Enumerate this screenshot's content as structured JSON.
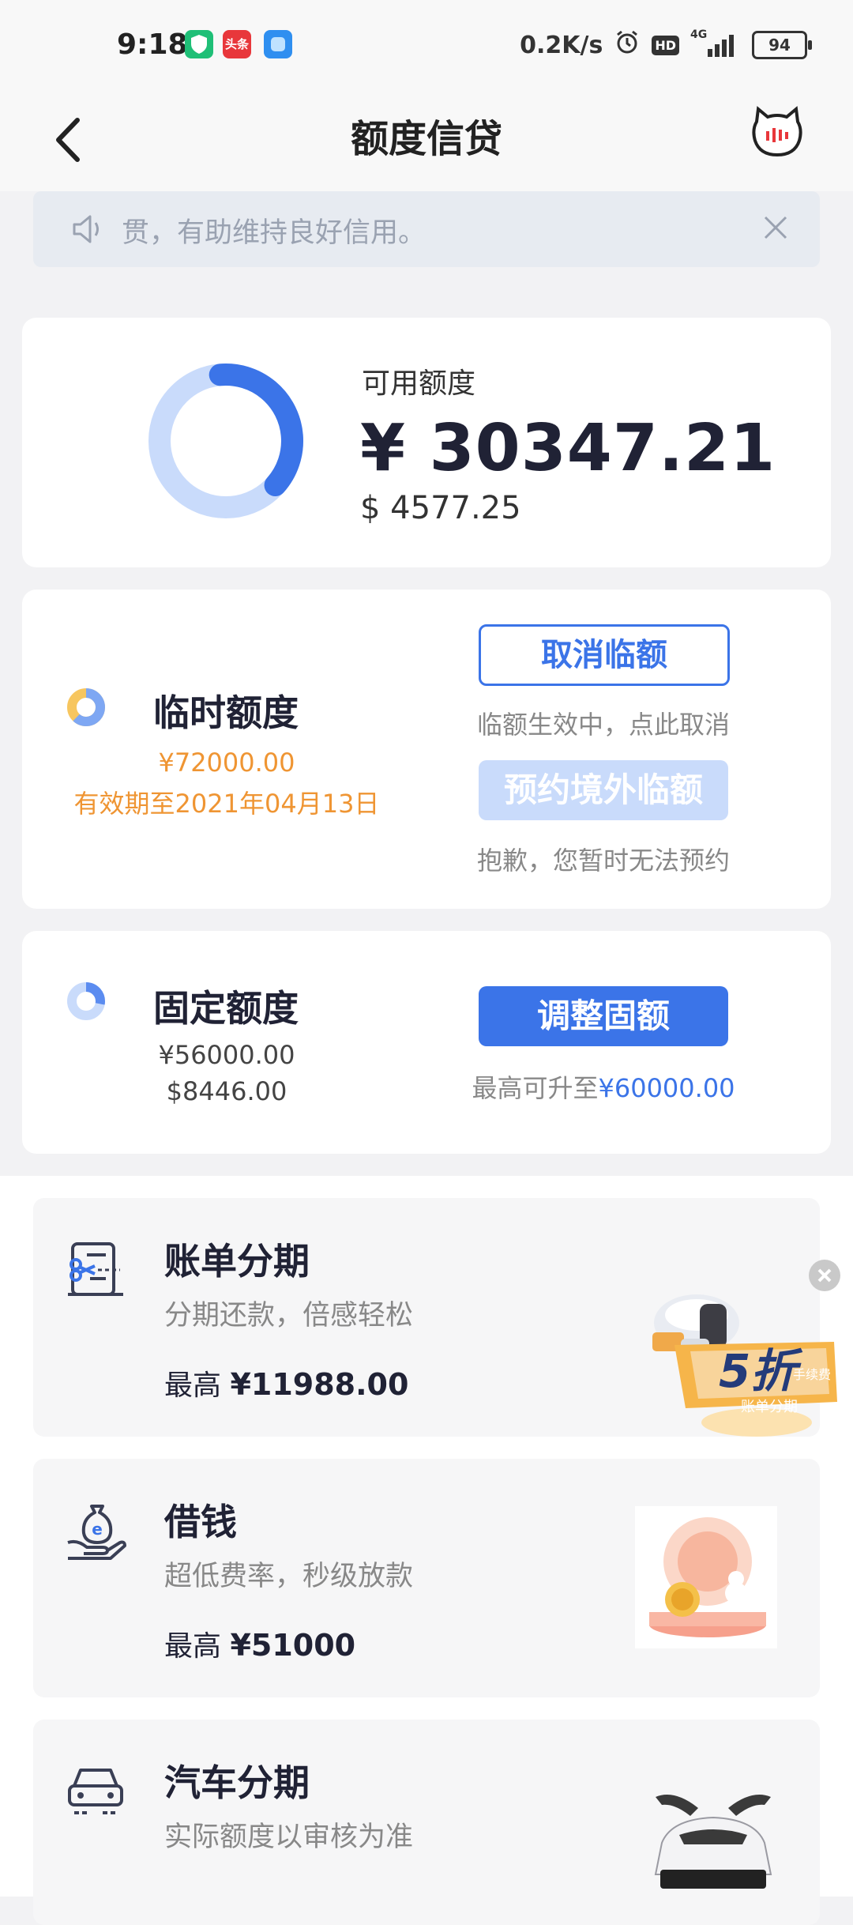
{
  "status_bar": {
    "time": "9:18",
    "network_speed": "0.2K/s",
    "hd": "HD",
    "signal": "4G",
    "battery": "94",
    "app_badge_text": "头条"
  },
  "nav": {
    "title": "额度信贷"
  },
  "notice": {
    "text": "贯，有助维持良好信用。"
  },
  "available": {
    "label": "可用额度",
    "rmb": "¥ 30347.21",
    "usd": "$ 4577.25"
  },
  "temporary": {
    "title": "临时额度",
    "amount": "¥72000.00",
    "validity": "有效期至2021年04月13日",
    "cancel_button": "取消临额",
    "cancel_hint": "临额生效中，点此取消",
    "reserve_button": "预约境外临额",
    "reserve_hint": "抱歉，您暂时无法预约"
  },
  "fixed": {
    "title": "固定额度",
    "rmb": "¥56000.00",
    "usd": "$8446.00",
    "adjust_button": "调整固额",
    "hint_prefix": "最高可升至",
    "hint_amount": "¥60000.00"
  },
  "products": [
    {
      "title": "账单分期",
      "subtitle": "分期还款，倍感轻松",
      "max_label": "最高",
      "max_value": "¥11988.00"
    },
    {
      "title": "借钱",
      "subtitle": "超低费率，秒级放款",
      "max_label": "最高",
      "max_value": "¥51000"
    },
    {
      "title": "汽车分期",
      "subtitle": "实际额度以审核为准",
      "max_label": "",
      "max_value": ""
    }
  ],
  "promo": {
    "discount": "5折",
    "fee_label": "手续费",
    "tag": "账单分期"
  },
  "colors": {
    "primary": "#3b74e8",
    "primary_light": "#c9dbfb",
    "orange": "#ef9533",
    "ring_light": "#c9dbfb",
    "ring_dark": "#3b74e8"
  },
  "ring_levels": {
    "available_fraction": 0.38,
    "temporary_fraction": 0.62,
    "fixed_fraction": 0.28
  }
}
